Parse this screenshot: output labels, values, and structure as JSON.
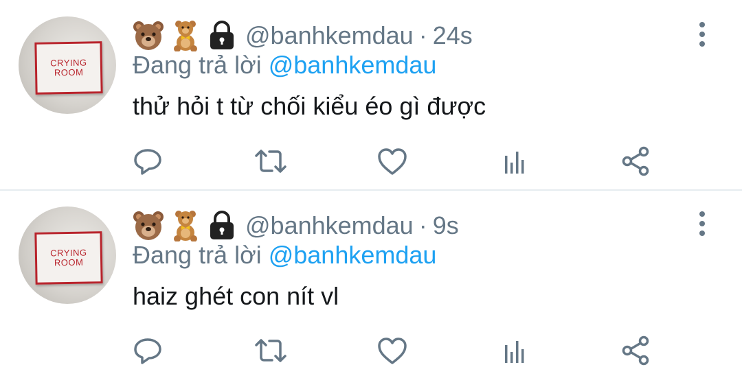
{
  "tweets": [
    {
      "avatar_sign": [
        "CRYING",
        "ROOM"
      ],
      "handle": "@banhkemdau",
      "separator": "·",
      "time": "24s",
      "reply_prefix": "Đang trả lời",
      "reply_to": "@banhkemdau",
      "text": "thử hỏi t từ chối kiểu éo gì được"
    },
    {
      "avatar_sign": [
        "CRYING",
        "ROOM"
      ],
      "handle": "@banhkemdau",
      "separator": "·",
      "time": "9s",
      "reply_prefix": "Đang trả lời",
      "reply_to": "@banhkemdau",
      "text": "haiz ghét con nít vl"
    }
  ],
  "icons": {
    "name_emojis": [
      "bear-face-icon",
      "teddy-bear-icon",
      "lock-icon"
    ],
    "actions": [
      "reply-icon",
      "retweet-icon",
      "like-icon",
      "analytics-icon",
      "share-icon"
    ],
    "menu": "more-vertical-icon"
  },
  "colors": {
    "text": "#14171a",
    "secondary": "#657786",
    "mention": "#1da1f2",
    "divider": "#e6ecf0"
  }
}
